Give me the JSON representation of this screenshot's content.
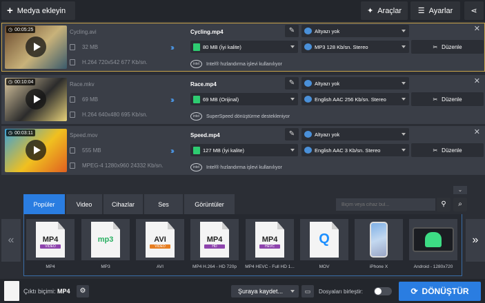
{
  "toolbar": {
    "add_media": "Medya ekleyin",
    "tools": "Araçlar",
    "settings": "Ayarlar"
  },
  "files": [
    {
      "duration": "00:05:25",
      "source_name": "Cycling.avi",
      "source_size": "32 MB",
      "source_info": "H.264 720x542 677 Kb/sn.",
      "output_name": "Cycling.mp4",
      "subtitle": "Altyazı yok",
      "output_size": "80 MB (İyi kalite)",
      "audio": "MP3 128 Kb/sn. Stereo",
      "hint": "Intel® hızlandırma işlevi kullanılıyor",
      "edit_label": "Düzenle",
      "thumb": [
        "#6b4a2e",
        "#c8b27a",
        "#3a5a6b"
      ]
    },
    {
      "duration": "00:10:04",
      "source_name": "Race.mkv",
      "source_size": "69 MB",
      "source_info": "H.264 640x480 695 Kb/sn.",
      "output_name": "Race.mp4",
      "subtitle": "Altyazı yok",
      "output_size": "69 MB (Orijinal)",
      "audio": "English AAC 256 Kb/sn. Stereo",
      "hint": "SuperSpeed dönüştürme destekleniyor",
      "edit_label": "Düzenle",
      "thumb": [
        "#d9c7a0",
        "#2b2b2b",
        "#e8d27a"
      ]
    },
    {
      "duration": "00:03:11",
      "source_name": "Speed.mov",
      "source_size": "555 MB",
      "source_info": "MPEG-4 1280x960 24332 Kb/sn.",
      "output_name": "Speed.mp4",
      "subtitle": "Altyazı yok",
      "output_size": "127 MB (İyi kalite)",
      "audio": "English AAC 3 Kb/sn. Stereo",
      "hint": "Intel® hızlandırma işlevi kullanılıyor",
      "edit_label": "Düzenle",
      "thumb": [
        "#3aa0d8",
        "#f0c020",
        "#e06020"
      ]
    }
  ],
  "tabs": [
    "Popüler",
    "Video",
    "Cihazlar",
    "Ses",
    "Görüntüler"
  ],
  "search": {
    "placeholder": "Biçim veya cihaz bul..."
  },
  "formats": [
    {
      "caption": "MP4",
      "label": "MP4",
      "sub": "VIDEO",
      "sub_color": "#8e44ad"
    },
    {
      "caption": "MP3",
      "label": "mp3",
      "sub": "",
      "sub_color": "#27ae60"
    },
    {
      "caption": "AVI",
      "label": "AVI",
      "sub": "VIDEO",
      "sub_color": "#e67e22"
    },
    {
      "caption": "MP4 H.264 - HD 720p",
      "label": "MP4",
      "sub": "HD",
      "sub_color": "#8e44ad"
    },
    {
      "caption": "MP4 HEVC - Full HD 1...",
      "label": "MP4",
      "sub": "HEVC",
      "sub_color": "#8e44ad"
    },
    {
      "caption": "MOV",
      "label": "Q",
      "sub": "",
      "sub_color": "#1e90ff"
    },
    {
      "caption": "iPhone X",
      "label": "",
      "sub": "",
      "sub_color": ""
    },
    {
      "caption": "Android - 1280x720",
      "label": "",
      "sub": "",
      "sub_color": ""
    }
  ],
  "bottom": {
    "output_format_label": "Çıktı biçimi:",
    "output_format": "MP4",
    "save_to": "Şuraya kaydet...",
    "merge_label": "Dosyaları birleştir:",
    "convert": "DÖNÜŞTÜR"
  }
}
